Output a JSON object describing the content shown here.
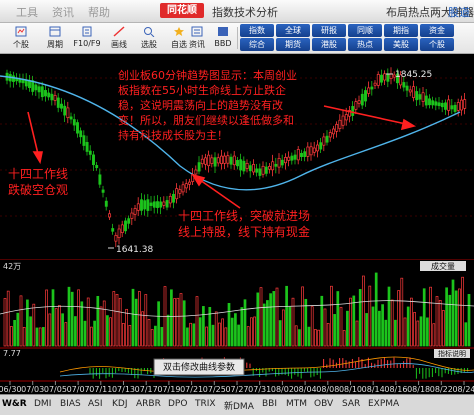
{
  "menu": [
    "工具",
    "资讯",
    "帮助"
  ],
  "app_logo": "同花顺",
  "window_title": "指数技术分析",
  "promo_text": "布局热点两大神器",
  "promo_link": "股道",
  "toolbar": {
    "buttons": [
      {
        "label": "个股",
        "icon": "stock-icon"
      },
      {
        "label": "周期",
        "icon": "period-icon"
      },
      {
        "label": "F10/F9",
        "icon": "f10-icon"
      },
      {
        "label": "画线",
        "icon": "draw-line-icon"
      },
      {
        "label": "选股",
        "icon": "stock-pick-icon"
      },
      {
        "label": "自选",
        "icon": "watchlist-icon"
      },
      {
        "label": "资讯",
        "icon": "news-icon"
      },
      {
        "label": "BBD",
        "icon": "bbd-icon"
      }
    ],
    "blue_buttons": [
      "指数",
      "综合",
      "全球",
      "期货",
      "研报",
      "港股",
      "同顺",
      "热点",
      "期指",
      "美股",
      "资金",
      "个股"
    ]
  },
  "annotations": {
    "main": [
      "创业板60分钟趋势图显示：本周创业",
      "板指数在55小时生命线上方止跌企",
      "稳，这说明震荡向上的趋势没有改",
      "变！所以，朋友们继续以逢低做多和",
      "持有科技成长股为主！"
    ],
    "left": [
      "十四工作线",
      "跌破空仓观"
    ],
    "bottom": [
      "十四工作线，突破就进场",
      "线上持股，线下持有现金"
    ]
  },
  "price_labels": {
    "high": "1845.25",
    "low": "1641.38"
  },
  "volume_label": "42万",
  "volume_button": "成交量",
  "indicator_value": "7.77",
  "indicator_hint": "双击修改曲线参数",
  "indicator_button": "指标说明",
  "dates": [
    "06/30",
    "07/03",
    "07/05",
    "07/07",
    "07/11",
    "07/13",
    "07/17",
    "07/19",
    "07/21",
    "07/25",
    "07/27",
    "07/31",
    "08/02",
    "08/04",
    "08/08",
    "08/10",
    "08/14",
    "08/16",
    "08/18",
    "08/22",
    "08/24"
  ],
  "bottom_tabs": [
    "W&R",
    "DMI",
    "BIAS",
    "ASI",
    "KDJ",
    "ARBR",
    "DPO",
    "TRIX",
    "新DMA",
    "BBI",
    "MTM",
    "OBV",
    "SAR",
    "EXPMA"
  ],
  "colors": {
    "up": "#ff3b3b",
    "down": "#1cc41c",
    "ma": "#4fb4ea",
    "annotation": "#ff2020"
  }
}
